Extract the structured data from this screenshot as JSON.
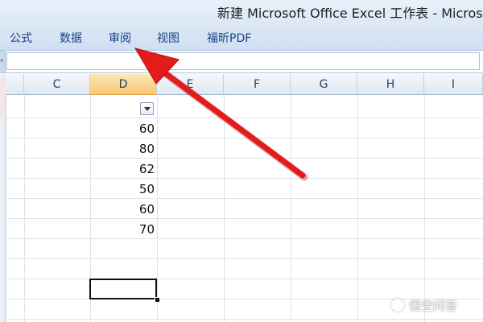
{
  "window": {
    "title": "新建 Microsoft Office Excel 工作表 - Microso"
  },
  "ribbon": {
    "tabs": [
      "公式",
      "数据",
      "审阅",
      "视图",
      "福昕PDF"
    ]
  },
  "formula_bar": {
    "value": ""
  },
  "grid": {
    "columns": [
      "C",
      "D",
      "E",
      "F",
      "G",
      "H",
      "I"
    ],
    "selected_column": "D",
    "column_d_values": [
      "60",
      "80",
      "62",
      "50",
      "60",
      "70"
    ]
  },
  "annotation": {
    "arrow_color": "#e31b1b",
    "points_to": "审阅"
  },
  "watermark": {
    "text": "悟空问答"
  },
  "colors": {
    "ribbon_text": "#15428b",
    "selected_header": "#f7c777"
  }
}
